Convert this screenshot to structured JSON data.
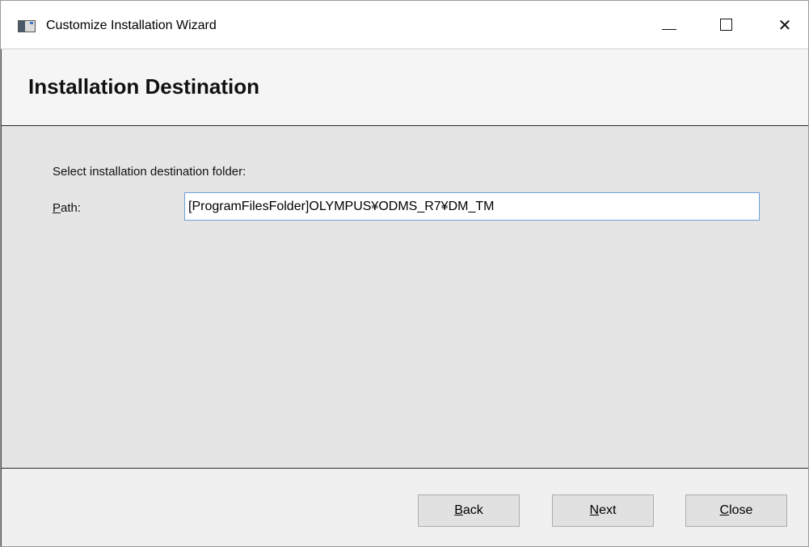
{
  "window": {
    "title": "Customize Installation Wizard",
    "icon": "app-window-icon",
    "controls": {
      "minimize_icon": "minimize-icon",
      "maximize_icon": "maximize-icon",
      "close_glyph": "✕"
    }
  },
  "header": {
    "title": "Installation Destination"
  },
  "content": {
    "instruction": "Select installation destination folder:",
    "path_label_mnemonic": "P",
    "path_label_rest": "ath:",
    "path_value": "[ProgramFilesFolder]OLYMPUS¥ODMS_R7¥DM_TM"
  },
  "footer": {
    "back_mnemonic": "B",
    "back_rest": "ack",
    "next_mnemonic": "N",
    "next_rest": "ext",
    "close_mnemonic": "C",
    "close_rest": "lose"
  },
  "colors": {
    "input_border_focus": "#6f9fd8",
    "content_background": "#e5e5e5",
    "header_background": "#f5f5f5"
  }
}
